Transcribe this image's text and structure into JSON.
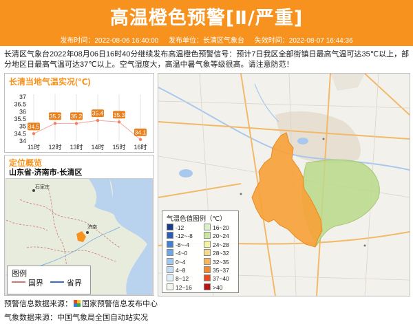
{
  "header": {
    "title": "高温橙色预警[Ⅱ/严重]",
    "issue_time": "发布时间：2022-08-06 16:40:00",
    "issuer": "发布单位：长清区气象台",
    "expire_time": "失效时间：2022-08-07 16:44:36"
  },
  "summary": "长清区气象台2022年08月06日16时40分继续发布高温橙色预警信号：预计7日我区全部街镇日最高气温可达35℃以上，部分地区日最高气温可达37℃以上。空气湿度大，高温中暑气象等级很高。请注意防范！",
  "temp_panel": {
    "title": "长清当地气温实况(℃)"
  },
  "chart_data": {
    "type": "line",
    "title": "长清当地气温实况(℃)",
    "categories": [
      "11时",
      "12时",
      "13时",
      "14时",
      "15时",
      "16时"
    ],
    "values": [
      34.5,
      35.2,
      35.2,
      35.4,
      35.3,
      34.1
    ],
    "yticks": [
      "37",
      "36.5",
      "36",
      "35.5",
      "35",
      "34.5",
      "34"
    ],
    "ylim": [
      34,
      37
    ]
  },
  "location": {
    "title": "定位概览",
    "path": "山东省-济南市-长清区",
    "minimap_labels": {
      "shijiazhuang": "石家庄",
      "jinan": "济南"
    }
  },
  "legend": {
    "title": "图例",
    "national": "国界",
    "provincial": "省界"
  },
  "color_legend": {
    "title": "气温色值图例（℃）",
    "items": [
      {
        "label": "-12",
        "color": "#1a3a8a"
      },
      {
        "label": "16~20",
        "color": "#d8f0c8"
      },
      {
        "label": "-12~-8",
        "color": "#2c5cb8"
      },
      {
        "label": "20~24",
        "color": "#c8e8a0"
      },
      {
        "label": "-8~-4",
        "color": "#3f7fd6"
      },
      {
        "label": "24~28",
        "color": "#f7f2a0"
      },
      {
        "label": "-4~0",
        "color": "#6ea6e8"
      },
      {
        "label": "28~32",
        "color": "#f6d98a"
      },
      {
        "label": "0~4",
        "color": "#a3c8f0"
      },
      {
        "label": "32~35",
        "color": "#f7b55c"
      },
      {
        "label": "4~8",
        "color": "#c5e0f6"
      },
      {
        "label": "35~37",
        "color": "#f58a2c"
      },
      {
        "label": "8~12",
        "color": "#def0fa"
      },
      {
        "label": "37~40",
        "color": "#e84c1e"
      },
      {
        "label": "12~16",
        "color": "#f0f8ec"
      },
      {
        "label": ">40",
        "color": "#c01010"
      }
    ]
  },
  "footer": {
    "warning_source": "预警信息数据来源：",
    "warning_org": "国家预警信息发布中心",
    "weather_source": "气象数据来源：中国气象局全国自动站实况"
  }
}
